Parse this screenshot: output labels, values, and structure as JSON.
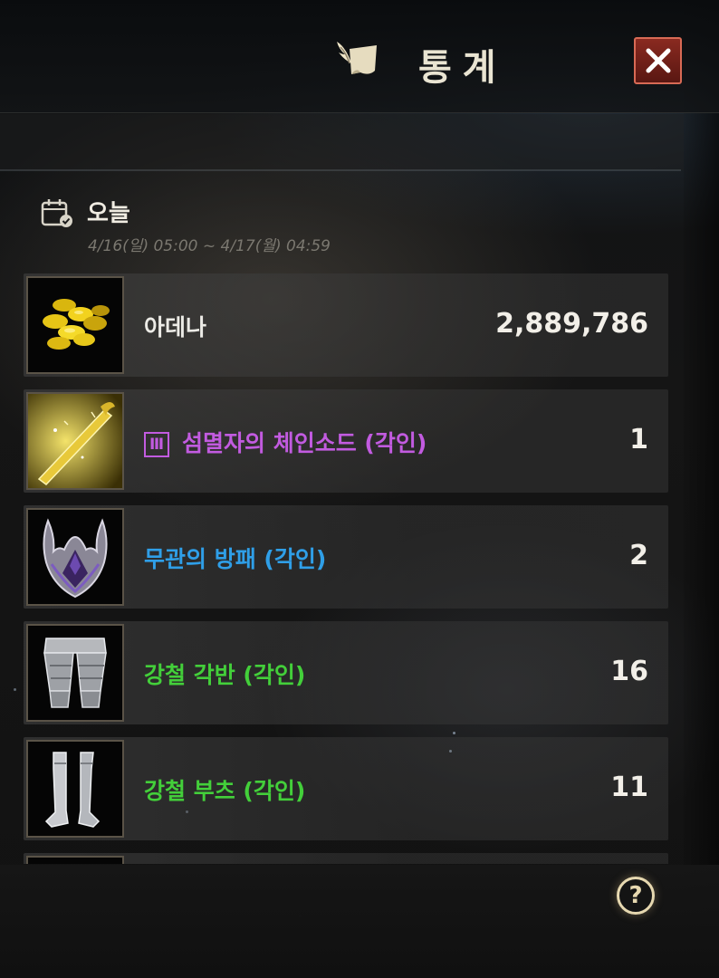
{
  "header": {
    "title": "통계"
  },
  "today": {
    "label": "오늘",
    "range": "4/16(일) 05:00 ~ 4/17(월) 04:59"
  },
  "items": [
    {
      "name": "아데나",
      "count": "2,889,786",
      "color": "#ecebe6",
      "icon": "adena-coins-icon"
    },
    {
      "name": "섬멸자의 체인소드 (각인)",
      "count": "1",
      "color": "#c25be0",
      "grade": "Ⅲ",
      "icon": "chainsword-icon"
    },
    {
      "name": "무관의 방패 (각인)",
      "count": "2",
      "color": "#2f9fe8",
      "icon": "shield-icon"
    },
    {
      "name": "강철 각반 (각인)",
      "count": "16",
      "color": "#43cf3a",
      "icon": "steel-greaves-icon"
    },
    {
      "name": "강철 부츠 (각인)",
      "count": "11",
      "color": "#43cf3a",
      "icon": "steel-boots-icon"
    }
  ],
  "colors": {
    "rare_purple": "#c25be0",
    "magic_blue": "#2f9fe8",
    "common_green": "#43cf3a",
    "close_red": "#8a2a20"
  }
}
